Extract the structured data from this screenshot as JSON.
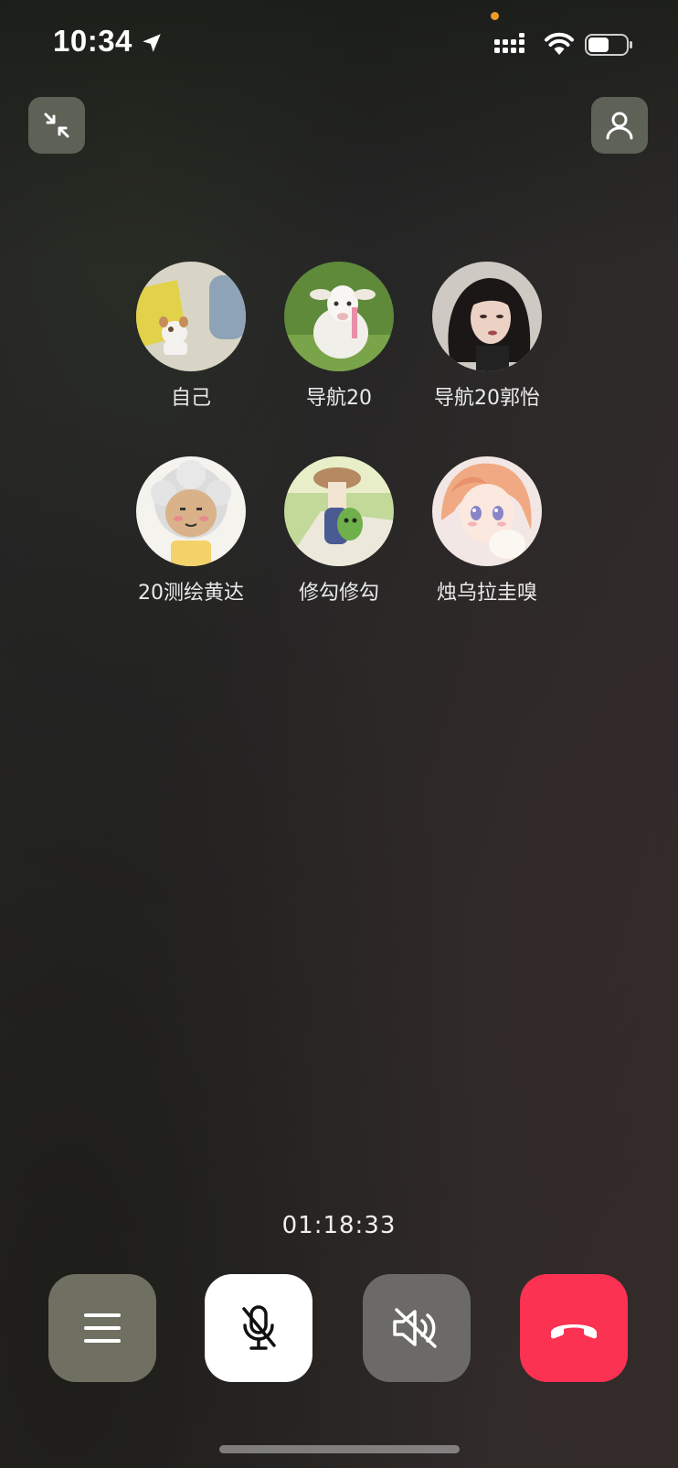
{
  "status_bar": {
    "time": "10:34",
    "icons": [
      "location-arrow-icon",
      "signal-icon",
      "wifi-icon",
      "battery-icon"
    ]
  },
  "top_controls": {
    "minimize_icon": "minimize-arrows-icon",
    "add_member_icon": "person-icon"
  },
  "participants": [
    {
      "name": "自己",
      "avatar": "plush-toy-photo"
    },
    {
      "name": "导航20",
      "avatar": "white-goat-photo"
    },
    {
      "name": "导航20郭怡",
      "avatar": "woman-portrait-photo"
    },
    {
      "name": "20测绘黄达",
      "avatar": "cartoon-sheep-avatar"
    },
    {
      "name": "修勾修勾",
      "avatar": "cartoon-mushroom-avatar"
    },
    {
      "name": "烛乌拉圭嗅",
      "avatar": "anime-girl-avatar"
    }
  ],
  "call": {
    "duration": "01:18:33"
  },
  "controls": [
    {
      "name": "menu-button",
      "icon": "menu-lines-icon"
    },
    {
      "name": "mute-mic-button",
      "icon": "mic-off-icon"
    },
    {
      "name": "speaker-off-button",
      "icon": "speaker-muted-icon"
    },
    {
      "name": "hang-up-button",
      "icon": "phone-hangup-icon"
    }
  ],
  "colors": {
    "hangup": "#fb3252",
    "mic_button_bg": "#ffffff",
    "control_bg": "#6f7061"
  }
}
